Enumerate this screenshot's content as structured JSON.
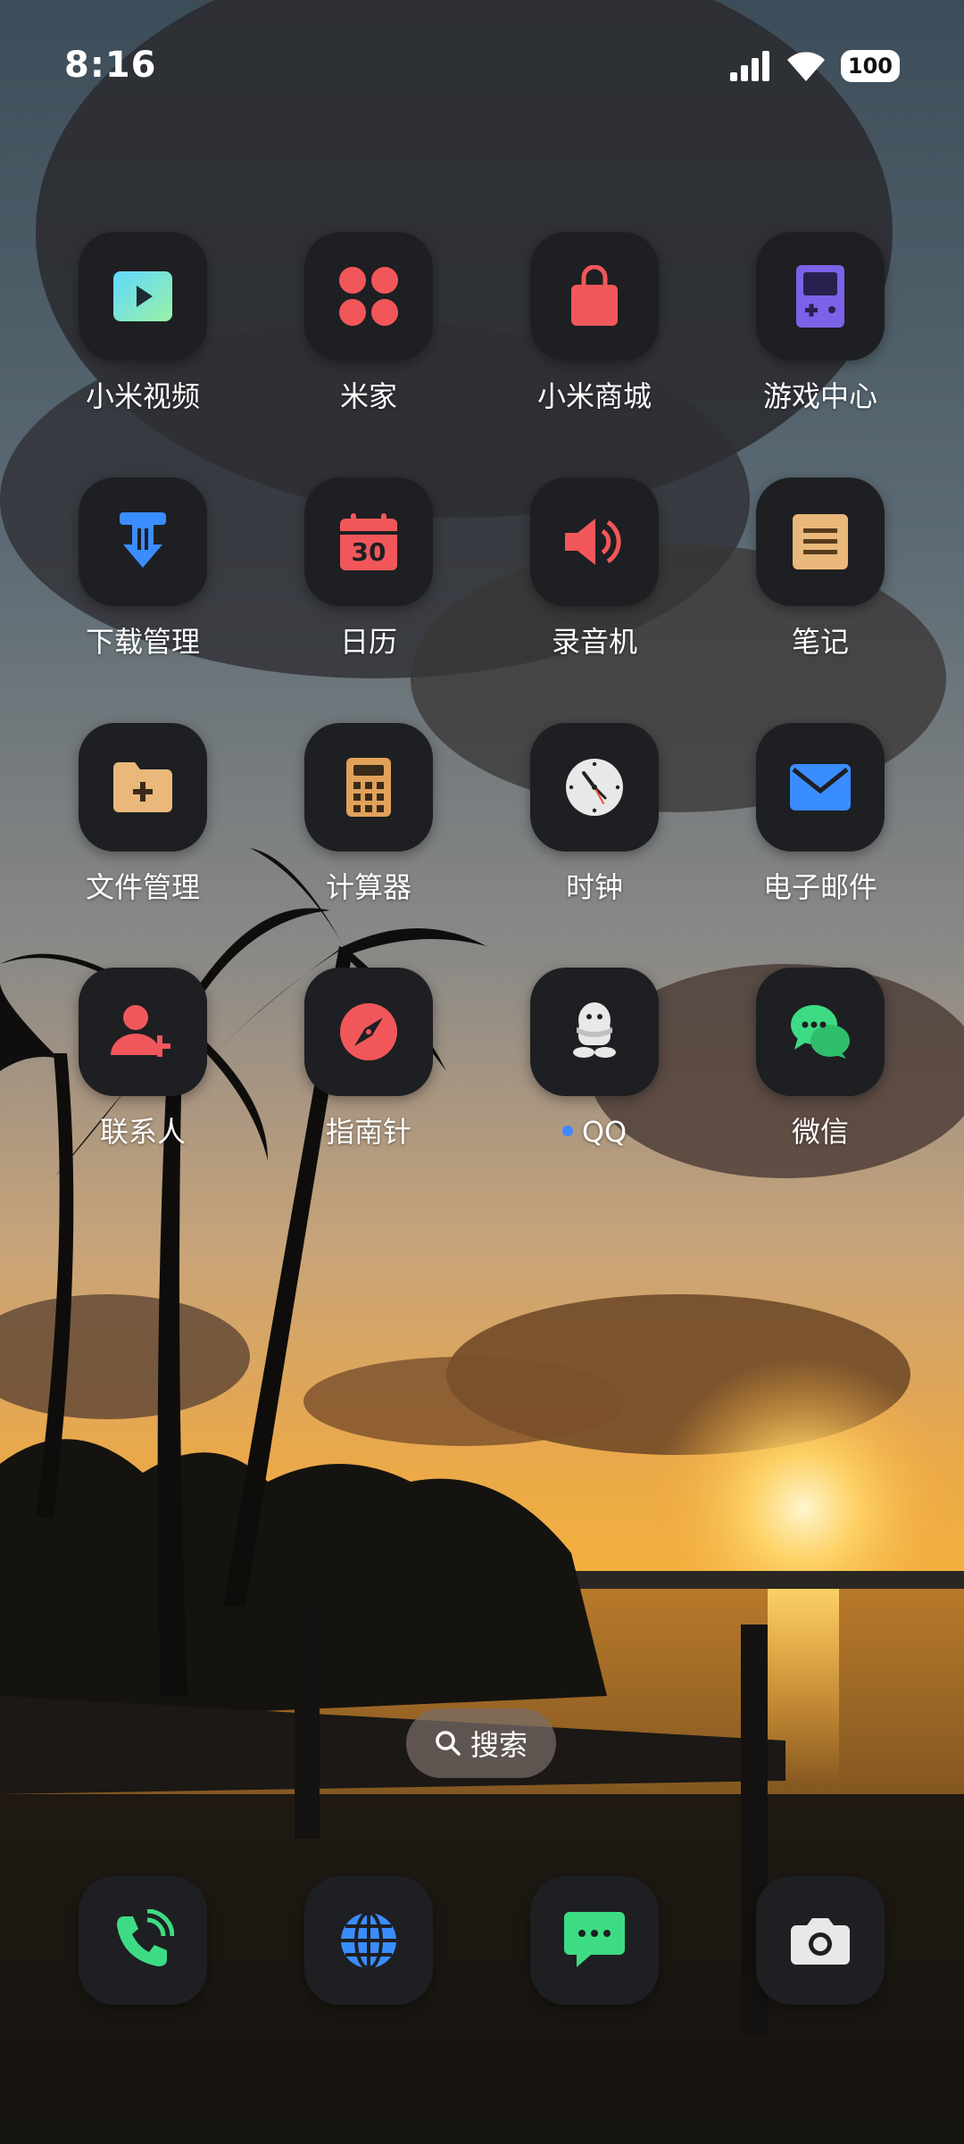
{
  "status_bar": {
    "time": "8:16",
    "battery": "100"
  },
  "home": {
    "apps": [
      {
        "label": "小米视频",
        "icon": "play-icon"
      },
      {
        "label": "米家",
        "icon": "four-dots-icon"
      },
      {
        "label": "小米商城",
        "icon": "shopping-bag-icon"
      },
      {
        "label": "游戏中心",
        "icon": "gameboy-icon"
      },
      {
        "label": "下载管理",
        "icon": "download-icon"
      },
      {
        "label": "日历",
        "icon": "calendar-icon",
        "day": "30"
      },
      {
        "label": "录音机",
        "icon": "speaker-icon"
      },
      {
        "label": "笔记",
        "icon": "notes-icon"
      },
      {
        "label": "文件管理",
        "icon": "folder-icon"
      },
      {
        "label": "计算器",
        "icon": "calculator-icon"
      },
      {
        "label": "时钟",
        "icon": "clock-icon"
      },
      {
        "label": "电子邮件",
        "icon": "mail-icon"
      },
      {
        "label": "联系人",
        "icon": "add-contact-icon"
      },
      {
        "label": "指南针",
        "icon": "compass-icon"
      },
      {
        "label": "QQ",
        "icon": "penguin-icon",
        "has_notification": true
      },
      {
        "label": "微信",
        "icon": "chat-bubbles-icon"
      }
    ]
  },
  "search": {
    "label": "搜索",
    "icon": "search-icon"
  },
  "dock": [
    {
      "icon": "phone-icon"
    },
    {
      "icon": "globe-icon"
    },
    {
      "icon": "message-icon"
    },
    {
      "icon": "camera-icon"
    }
  ],
  "colors": {
    "tile_bg": "#1e1f22",
    "notification_dot": "#3f86ff",
    "green_accent": "#3ddc84",
    "red_accent": "#f1575a",
    "blue_accent": "#3a8dff"
  }
}
